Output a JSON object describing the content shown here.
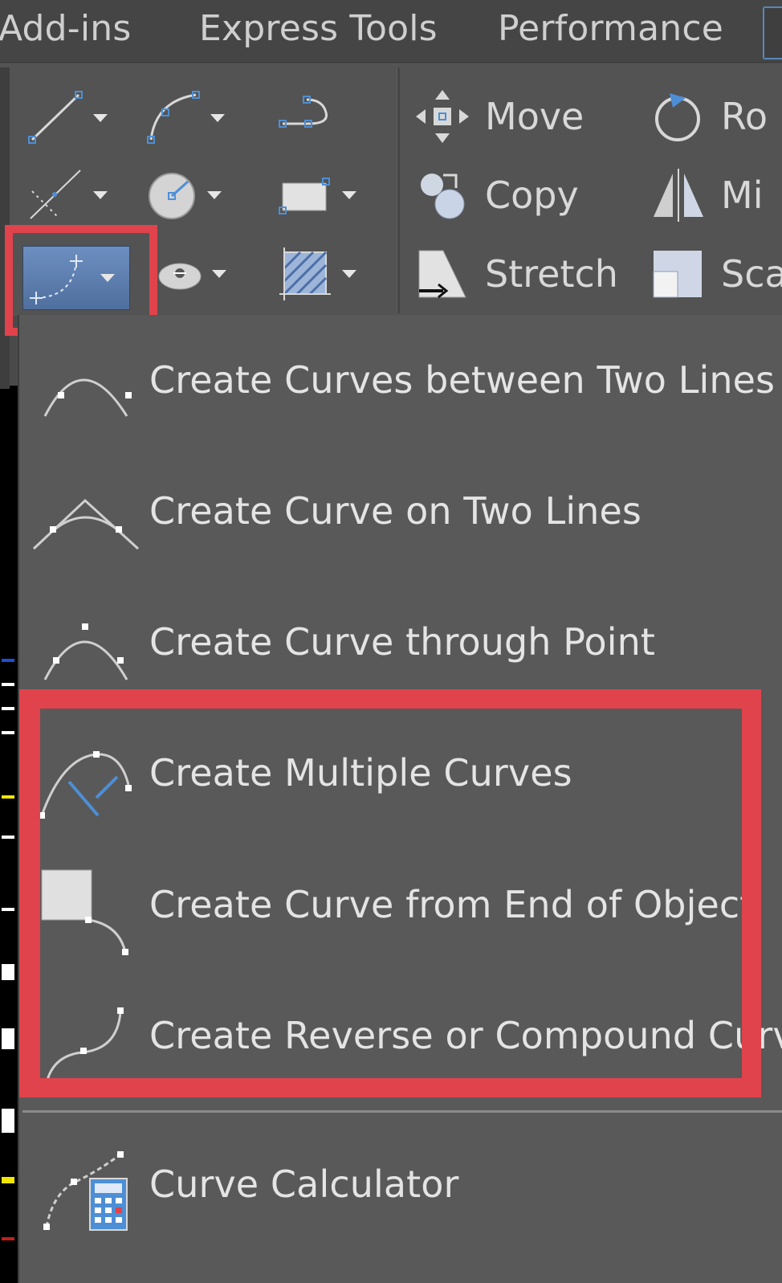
{
  "tabs": [
    "Add-ins",
    "Express Tools",
    "Performance"
  ],
  "modify_tools": [
    {
      "label": "Move",
      "icon": "move-icon"
    },
    {
      "label": "Copy",
      "icon": "copy-icon"
    },
    {
      "label": "Stretch",
      "icon": "stretch-icon"
    },
    {
      "label": "Ro",
      "icon": "rotate-icon"
    },
    {
      "label": "Mi",
      "icon": "mirror-icon"
    },
    {
      "label": "Sca",
      "icon": "scale-icon"
    }
  ],
  "curve_menu": {
    "items": [
      {
        "label": "Create Curves between Two Lines",
        "icon": "curve-between-lines-icon"
      },
      {
        "label": "Create Curve on Two Lines",
        "icon": "curve-on-two-lines-icon"
      },
      {
        "label": "Create Curve through Point",
        "icon": "curve-through-point-icon"
      },
      {
        "label": "Create Multiple Curves",
        "icon": "multiple-curves-icon"
      },
      {
        "label": "Create Curve from End of Object",
        "icon": "curve-from-end-icon"
      },
      {
        "label": "Create Reverse or Compound Curve",
        "icon": "reverse-compound-curve-icon"
      },
      {
        "label": "Curve Calculator",
        "icon": "curve-calculator-icon"
      }
    ]
  },
  "colors": {
    "highlight": "#e0434c",
    "menu_bg": "#595959",
    "ribbon_bg": "#535353",
    "accent_blue": "#4d8fd6"
  }
}
